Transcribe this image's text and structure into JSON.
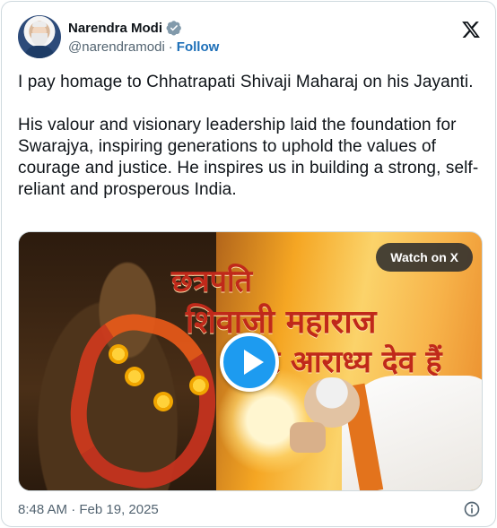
{
  "author": {
    "name": "Narendra Modi",
    "handle": "@narendramodi",
    "separator": "·",
    "follow_label": "Follow",
    "verified_icon": "verified-badge-icon"
  },
  "tweet": {
    "paragraphs": [
      "I pay homage to Chhatrapati Shivaji Maharaj on his Jayanti.",
      "His valour and visionary leadership laid the foundation for Swarajya, inspiring generations to uphold the values of courage and justice. He inspires us in building a strong, self-reliant and prosperous India."
    ]
  },
  "media": {
    "type": "video",
    "watch_label": "Watch on X",
    "overlay_text_line1": "छत्रपति",
    "overlay_text_line2": "शिवाजी महाराज",
    "overlay_text_line3": "हमारे आराध्य देव हैं",
    "play_icon": "play-icon"
  },
  "footer": {
    "timestamp": "8:48 AM · Feb 19, 2025",
    "info_icon": "info-icon"
  },
  "colors": {
    "follow": "#1d6fb8",
    "verified": "#829aab",
    "play_button": "#1d9bf0",
    "secondary_text": "#536471"
  }
}
